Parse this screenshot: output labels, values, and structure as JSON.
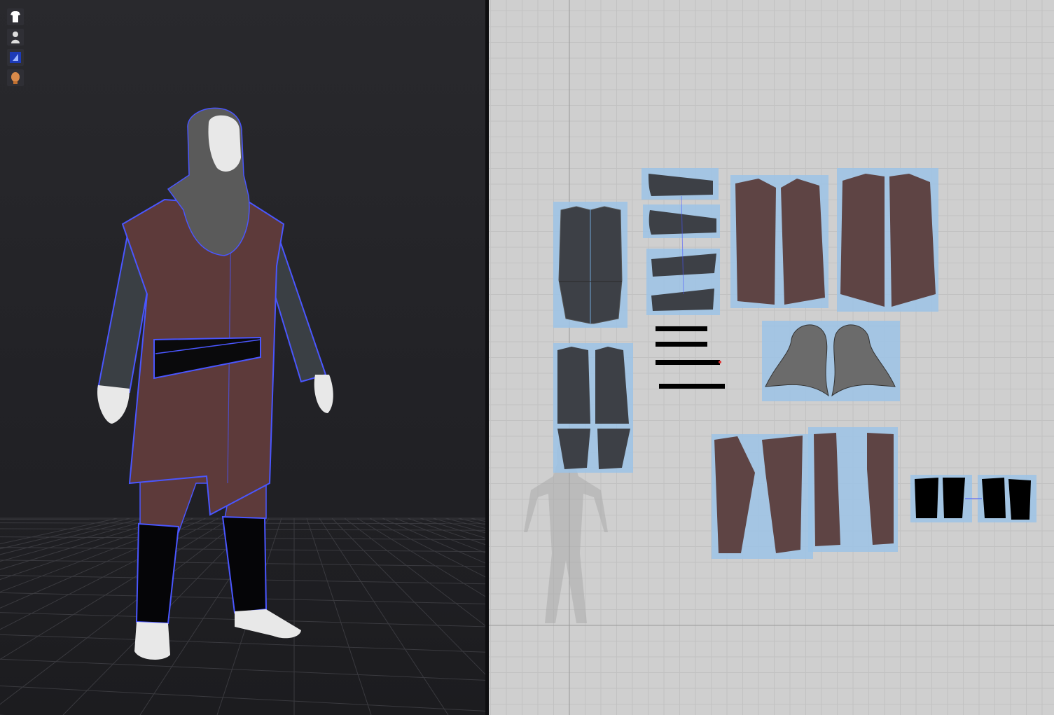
{
  "viewport_3d": {
    "toolbar": [
      {
        "icon": "garment-icon"
      },
      {
        "icon": "avatar-icon"
      },
      {
        "icon": "texture-icon"
      },
      {
        "icon": "avatar-head-icon"
      }
    ],
    "colors": {
      "background": "#242428",
      "floor_grid": "#3a3a3f",
      "seam": "#4a56ff",
      "tunic": "#5d3a3a",
      "hood": "#5a5a5a",
      "sleeve": "#3a3f44",
      "belt": "#0a0a0c",
      "avatar": "#e8e8e8"
    }
  },
  "viewport_2d": {
    "colors": {
      "background": "#cfcfcf",
      "grid": "#c0c0c0",
      "selection": "#9cc3e6",
      "tunic_piece": "#5e4444",
      "dark_piece": "#3d4046",
      "hood_piece": "#6b6b6b",
      "belt_piece": "#000000",
      "axis": "#9a9a9a"
    }
  }
}
